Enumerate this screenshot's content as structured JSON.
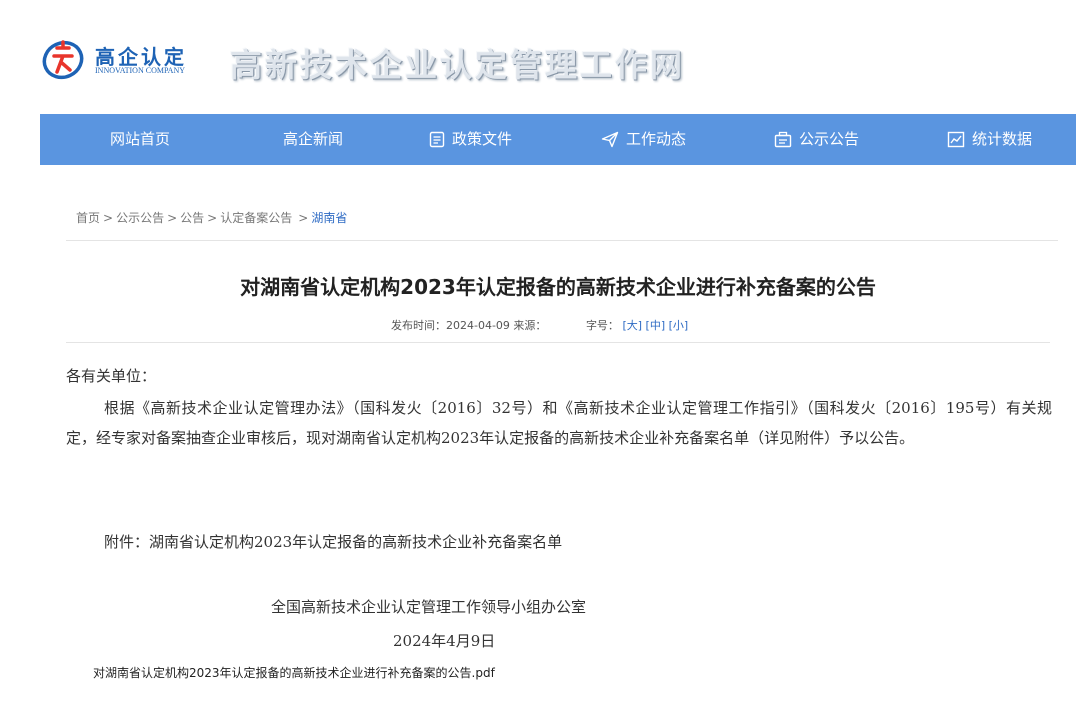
{
  "header": {
    "logo_cn": "高企认定",
    "logo_en": "INNOVATION COMPANY",
    "site_title": "高新技术企业认定管理工作网",
    "logo_icon": "stylized-gao-logo-icon"
  },
  "nav": {
    "items": [
      {
        "label": "网站首页",
        "icon": ""
      },
      {
        "label": "高企新闻",
        "icon": ""
      },
      {
        "label": "政策文件",
        "icon": "document-icon"
      },
      {
        "label": "工作动态",
        "icon": "send-icon"
      },
      {
        "label": "公示公告",
        "icon": "notice-icon"
      },
      {
        "label": "统计数据",
        "icon": "chart-icon"
      }
    ]
  },
  "breadcrumb": [
    "首页",
    "公示公告",
    "公告",
    "认定备案公告",
    "湖南省"
  ],
  "article": {
    "title": "对湖南省认定机构2023年认定报备的高新技术企业进行补充备案的公告",
    "meta_published": "发布时间：2024-04-09 来源：",
    "meta_fontsize_label": "字号：",
    "font_sizes": [
      "[大]",
      "[中]",
      "[小]"
    ],
    "salutation": "各有关单位：",
    "paragraph": "根据《高新技术企业认定管理办法》（国科发火〔2016〕32号）和《高新技术企业认定管理工作指引》（国科发火〔2016〕195号）有关规定，经专家对备案抽查企业审核后，现对湖南省认定机构2023年认定报备的高新技术企业补充备案名单（详见附件）予以公告。",
    "attachment": "附件：湖南省认定机构2023年认定报备的高新技术企业补充备案名单",
    "signature_org": "全国高新技术企业认定管理工作领导小组办公室",
    "signature_date": "2024年4月9日",
    "pdf_link": "对湖南省认定机构2023年认定报备的高新技术企业进行补充备案的公告.pdf"
  },
  "colors": {
    "nav_bg": "#5a95e0",
    "brand_blue": "#1e63b5",
    "brand_red": "#e8352c",
    "link_blue": "#2e6bc4"
  }
}
